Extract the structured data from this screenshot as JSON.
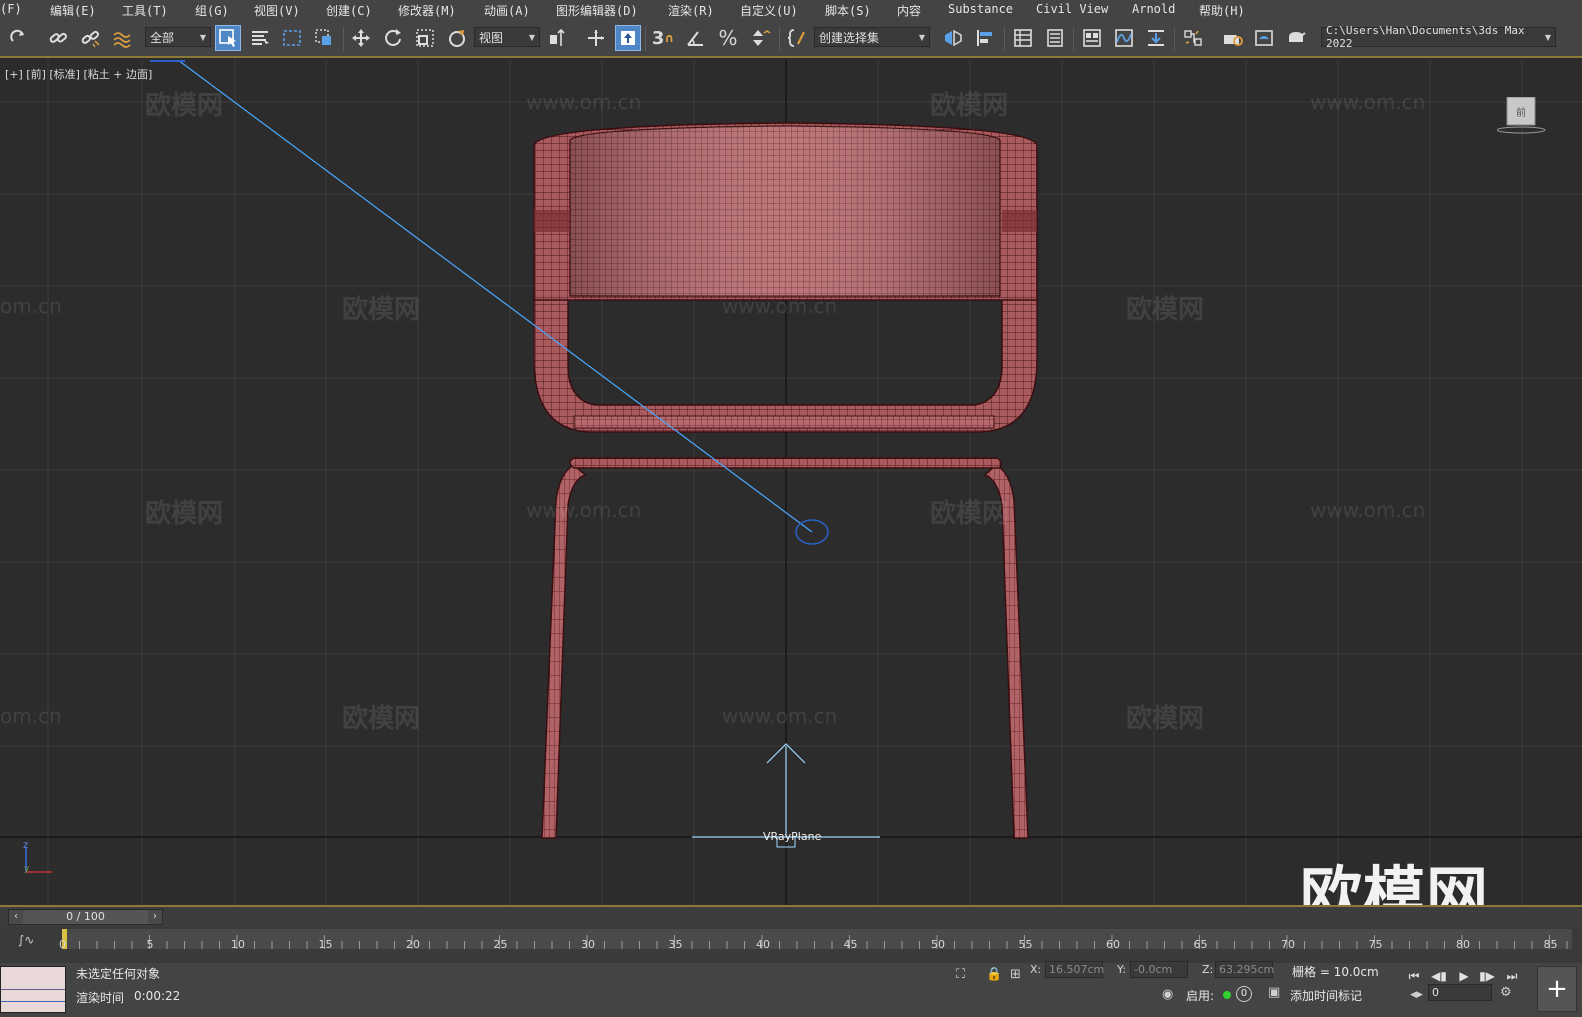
{
  "menu": {
    "items": [
      "(F)",
      "编辑(E)",
      "工具(T)",
      "组(G)",
      "视图(V)",
      "创建(C)",
      "修改器(M)",
      "动画(A)",
      "图形编辑器(D)",
      "渲染(R)",
      "自定义(U)",
      "脚本(S)",
      "内容",
      "Substance",
      "Civil View",
      "Arnold",
      "帮助(H)"
    ]
  },
  "toolbar": {
    "selection_filter": "全部",
    "ref_coord": "视图",
    "named_selection": "创建选择集",
    "project_path": "C:\\Users\\Han\\Documents\\3ds Max 2022",
    "snap_label": "3"
  },
  "viewport": {
    "label": "[+] [前] [标准] [粘土 + 边面]",
    "viewcube_label": "前",
    "object_label": "VRayPlane",
    "watermark_text": "欧模网",
    "watermark_url": "www.om.cn",
    "watermark_url_edge": "om.cn",
    "corner_watermark": "欧模网",
    "axis_z": "z",
    "axis_y": "y"
  },
  "timeline": {
    "frame_display": "0 / 100",
    "ticks": [
      "0",
      "5",
      "10",
      "15",
      "20",
      "25",
      "30",
      "35",
      "40",
      "45",
      "50",
      "55",
      "60",
      "65",
      "70",
      "75",
      "80",
      "85"
    ]
  },
  "status": {
    "selection": "未选定任何对象",
    "render_time_label": "渲染时间",
    "render_time": "0:00:22",
    "x_label": "X:",
    "x_value": "16.507cm",
    "y_label": "Y:",
    "y_value": "-0.0cm",
    "z_label": "Z:",
    "z_value": "63.295cm",
    "grid": "栅格 = 10.0cm",
    "enable_label": "启用:",
    "enable_count": "0",
    "add_time_tag": "添加时间标记",
    "frame_field": "0"
  },
  "colors": {
    "ui_bg": "#444444",
    "viewport_bg": "#2c2c2c",
    "accent_gold": "#8a7a35",
    "active_blue": "#4f86c6",
    "chair_fill": "#b86a6e",
    "chair_wire": "#5a1e20"
  }
}
